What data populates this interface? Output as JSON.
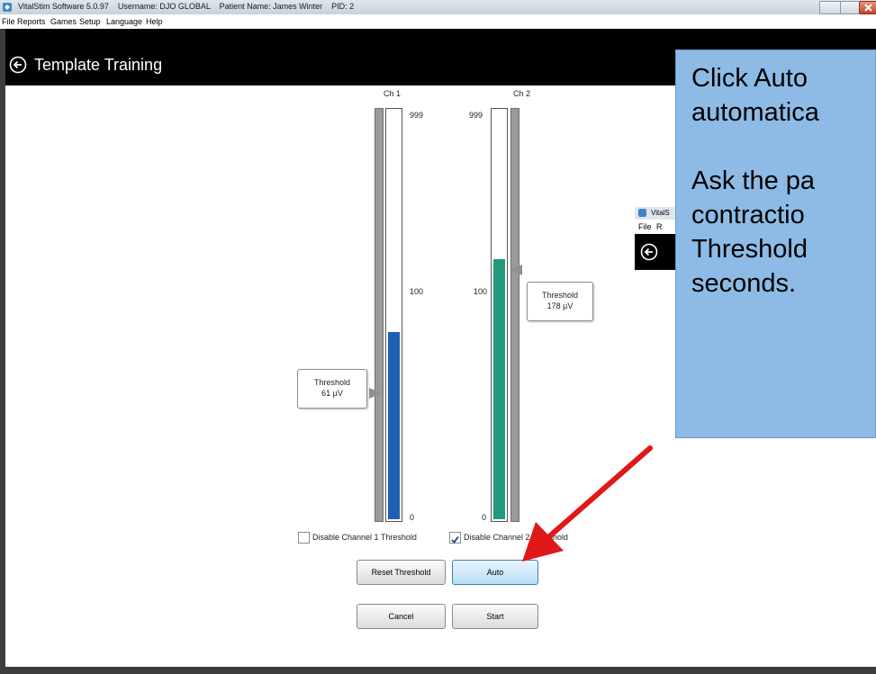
{
  "window": {
    "title": "VitalStim Software 5.0.97    Username: DJO GLOBAL    Patient Name: James Winter    PID: 2"
  },
  "menu": [
    "File",
    "Reports",
    "Games",
    "Setup",
    "Language",
    "Help"
  ],
  "header": {
    "title": "Template Training"
  },
  "channels": [
    {
      "label": "Ch 1",
      "scale_top": "999",
      "scale_mid": "100",
      "scale_bottom": "0",
      "threshold_label": "Threshold",
      "threshold_value": "61 µV",
      "level_percent": 46,
      "fill_color": "#1f5fb0"
    },
    {
      "label": "Ch 2",
      "scale_top": "999",
      "scale_mid": "100",
      "scale_bottom": "0",
      "threshold_label": "Threshold",
      "threshold_value": "178 µV",
      "level_percent": 64,
      "fill_color": "#1f9a7e"
    }
  ],
  "checkboxes": [
    {
      "label": "Disable Channel 1 Threshold",
      "checked": false
    },
    {
      "label": "Disable Channel 2 Threshold",
      "checked": true
    }
  ],
  "buttons": {
    "reset_threshold": "Reset Threshold",
    "auto": "Auto",
    "cancel": "Cancel",
    "start": "Start"
  },
  "background_window": {
    "title": "VitalS",
    "menu": [
      "File",
      "R"
    ]
  },
  "callout": {
    "text": "Click Auto\nautomatica\n\nAsk the pa\ncontractio\nThreshold\nseconds."
  }
}
